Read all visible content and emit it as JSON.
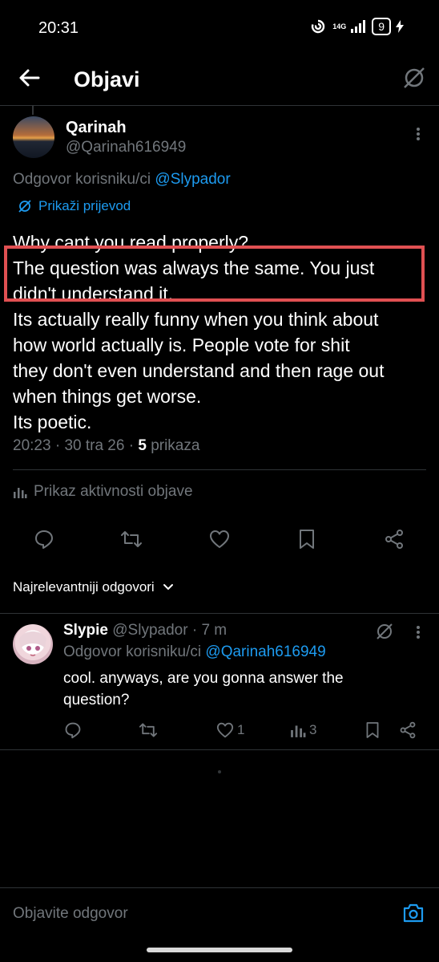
{
  "status_bar": {
    "time": "20:31",
    "network": "14G",
    "battery": "9"
  },
  "header": {
    "title": "Objavi"
  },
  "post": {
    "author_name": "Qarinah",
    "author_handle": "@Qarinah616949",
    "reply_prefix": "Odgovor korisniku/ci",
    "reply_to": "@Slypador",
    "translate_label": "Prikaži prijevod",
    "text_lines": [
      "Why cant you read properly?",
      "The question was always the same. You just",
      "didn't understand it.",
      "Its actually really funny when you think about",
      "how world actually is. People vote for shit",
      "they don't even understand and then rage out",
      "when things get worse.",
      "Its poetic."
    ],
    "time": "20:23",
    "date": "30 tra 26",
    "views_count": "5",
    "views_label": "prikaza",
    "activity_label": "Prikaz aktivnosti objave"
  },
  "sort_label": "Najrelevantniji odgovori",
  "reply": {
    "author_name": "Slypie",
    "author_handle": "@Slypador",
    "age": "7 m",
    "reply_prefix": "Odgovor korisniku/ci",
    "reply_to": "@Qarinah616949",
    "text_lines": [
      "cool. anyways, are you gonna answer the",
      "question?"
    ],
    "likes": "1",
    "views": "3"
  },
  "compose": {
    "placeholder": "Objavite odgovor"
  },
  "colors": {
    "accent": "#1d9bf0",
    "highlight_border": "#e05052",
    "muted": "#71767b",
    "background": "#000000"
  },
  "icons": [
    "back-arrow-icon",
    "translate-icon",
    "more-icon",
    "reply-icon",
    "retweet-icon",
    "like-icon",
    "bookmark-icon",
    "share-icon",
    "chart-icon",
    "chevron-down-icon",
    "camera-icon"
  ]
}
